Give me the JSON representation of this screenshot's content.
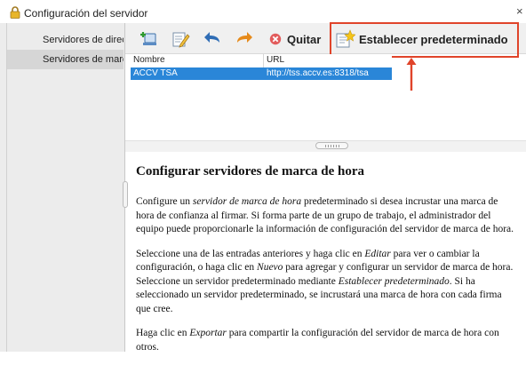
{
  "window": {
    "title": "Configuración del servidor",
    "close_glyph": "×"
  },
  "sidebar": {
    "items": [
      {
        "label": "Servidores de directorio",
        "selected": false
      },
      {
        "label": "Servidores de marca de hora",
        "selected": true
      }
    ]
  },
  "toolbar": {
    "buttons": [
      {
        "name": "new-icon"
      },
      {
        "name": "edit-icon"
      },
      {
        "name": "import-icon"
      },
      {
        "name": "export-icon"
      }
    ],
    "remove_label": "Quitar",
    "set_default_label": "Establecer predeterminado"
  },
  "table": {
    "columns": [
      "Nombre",
      "URL"
    ],
    "rows": [
      {
        "nombre": "ACCV TSA",
        "url": "http://tss.accv.es:8318/tsa",
        "selected": true
      }
    ]
  },
  "help": {
    "heading": "Configurar servidores de marca de hora",
    "p1": [
      {
        "text": "Configure un "
      },
      {
        "text": "servidor de marca de hora",
        "em": true
      },
      {
        "text": " predeterminado si desea incrustar una marca de hora de confianza al firmar. Si forma parte de un grupo de trabajo, el administrador del equipo puede proporcionarle la información de configuración del servidor de marca de hora."
      }
    ],
    "p2": [
      {
        "text": "Seleccione una de las entradas anteriores y haga clic en "
      },
      {
        "text": "Editar",
        "em": true
      },
      {
        "text": " para ver o cambiar la configuración, o haga clic en "
      },
      {
        "text": "Nuevo",
        "em": true
      },
      {
        "text": " para agregar y configurar un servidor de marca de hora. Seleccione un servidor predeterminado mediante "
      },
      {
        "text": "Establecer predeterminado",
        "em": true
      },
      {
        "text": ". Si ha seleccionado un servidor predeterminado, se incrustará una marca de hora con cada firma que cree."
      }
    ],
    "p3": [
      {
        "text": "Haga clic en "
      },
      {
        "text": "Exportar",
        "em": true
      },
      {
        "text": " para compartir la configuración del servidor de marca de hora con otros."
      }
    ]
  },
  "colors": {
    "accent": "#2a86d8",
    "highlight_box": "#e0442a"
  }
}
